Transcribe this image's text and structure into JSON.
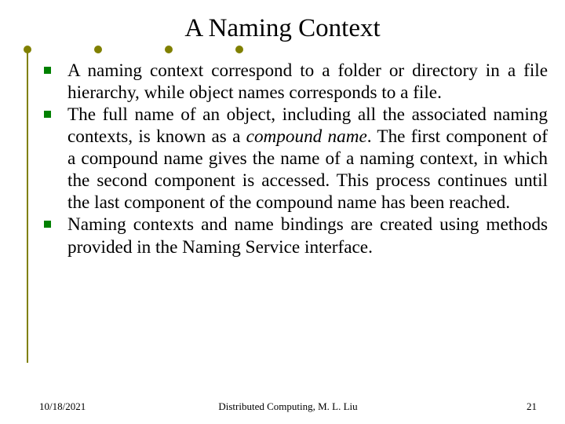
{
  "title": "A Naming Context",
  "bullets": {
    "b1": "A naming context correspond to a folder or directory in a file hierarchy, while object names corresponds to a file.",
    "b2a": "The full name of an object, including all the associated naming contexts, is known as a ",
    "b2_em": "compound name",
    "b2b": ". The first component of a compound name gives the name of a naming context, in which the second component is accessed. This process continues until the last component of the compound name has been reached.",
    "b3": "Naming contexts and name bindings are created using methods provided in the Naming Service interface."
  },
  "footer": {
    "date": "10/18/2021",
    "center": "Distributed Computing, M. L. Liu",
    "page": "21"
  }
}
